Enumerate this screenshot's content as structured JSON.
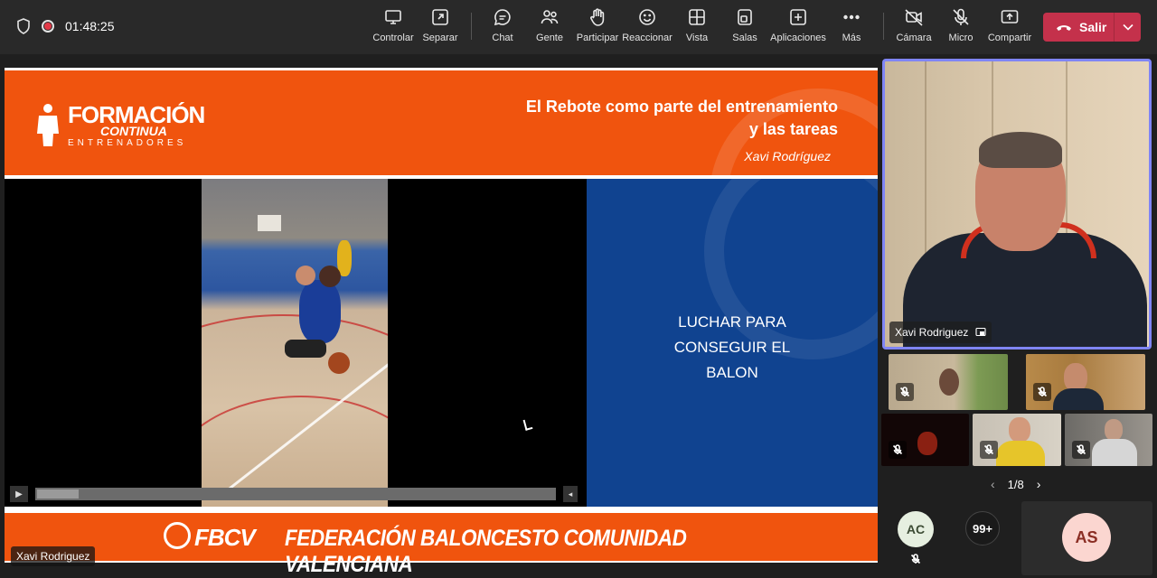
{
  "topbar": {
    "timer": "01:48:25",
    "buttons": [
      {
        "label": "Controlar",
        "icon": "monitor-icon"
      },
      {
        "label": "Separar",
        "icon": "popout-icon"
      },
      {
        "label": "Chat",
        "icon": "chat-icon"
      },
      {
        "label": "Gente",
        "icon": "people-icon"
      },
      {
        "label": "Participar",
        "icon": "raise-hand-icon"
      },
      {
        "label": "Reaccionar",
        "icon": "smile-icon"
      },
      {
        "label": "Vista",
        "icon": "grid-icon"
      },
      {
        "label": "Salas",
        "icon": "rooms-icon"
      },
      {
        "label": "Aplicaciones",
        "icon": "apps-icon"
      },
      {
        "label": "Más",
        "icon": "more-icon"
      },
      {
        "label": "Cámara",
        "icon": "camera-off-icon"
      },
      {
        "label": "Micro",
        "icon": "mic-off-icon"
      },
      {
        "label": "Compartir",
        "icon": "share-icon"
      }
    ],
    "leave_label": "Salir",
    "leave_color": "#c4314b"
  },
  "slide": {
    "logo_line1": "FORMACIÓN",
    "logo_line2": "CONTINUA",
    "logo_line3": "ENTRENADORES",
    "title_line1": "El Rebote como parte del entrenamiento",
    "title_line2": "y las tareas",
    "author": "Xavi Rodríguez",
    "panel_line1": "LUCHAR PARA",
    "panel_line2": "CONSEGUIR EL",
    "panel_line3": "BALON",
    "footer_brand": "FBCV",
    "footer_text": "FEDERACIÓN BALONCESTO COMUNIDAD VALENCIANA",
    "accent_color": "#f0540e",
    "panel_color": "#104390"
  },
  "presenter_tag": "Xavi Rodriguez",
  "main_video": {
    "name": "Xavi Rodriguez"
  },
  "pager": "1/8",
  "participants": {
    "ac_initials": "AC",
    "overflow": "99+",
    "as_initials": "AS"
  }
}
